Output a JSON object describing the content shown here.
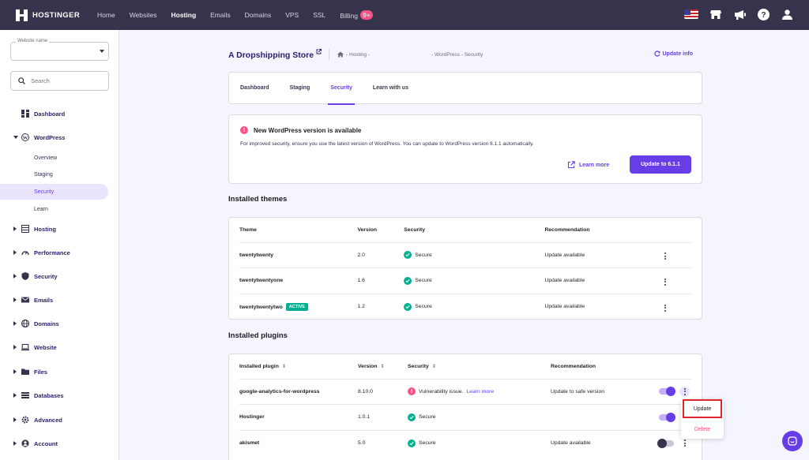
{
  "brand": {
    "name": "HOSTINGER"
  },
  "topnav": {
    "links": [
      "Home",
      "Websites",
      "Hosting",
      "Emails",
      "Domains",
      "VPS",
      "SSL",
      "Billing"
    ],
    "billing_badge": "9+"
  },
  "sidebar": {
    "website_select_label": "Website name",
    "search_placeholder": "Search",
    "items": [
      {
        "label": "Dashboard"
      },
      {
        "label": "WordPress"
      },
      {
        "label": "Hosting"
      },
      {
        "label": "Performance"
      },
      {
        "label": "Security"
      },
      {
        "label": "Emails"
      },
      {
        "label": "Domains"
      },
      {
        "label": "Website"
      },
      {
        "label": "Files"
      },
      {
        "label": "Databases"
      },
      {
        "label": "Advanced"
      },
      {
        "label": "Account"
      }
    ],
    "wp_subitems": [
      "Overview",
      "Staging",
      "Security",
      "Learn"
    ]
  },
  "header": {
    "site_title": "A Dropshipping Store",
    "breadcrumb_1": "- Hosting -",
    "breadcrumb_2": "- WordPress - Security",
    "update_info": "Update info"
  },
  "tabs": [
    "Dashboard",
    "Staging",
    "Security",
    "Learn with us"
  ],
  "alert": {
    "title": "New WordPress version is available",
    "description": "For improved security, ensure you use the latest version of WordPress. You can update to WordPress version 6.1.1 automatically.",
    "learn_more": "Learn more",
    "update_button": "Update to 6.1.1"
  },
  "themes": {
    "section_title": "Installed themes",
    "headers": [
      "Theme",
      "Version",
      "Security",
      "Recommendation"
    ],
    "rows": [
      {
        "name": "twentytwenty",
        "version": "2.0",
        "security": "Secure",
        "recommendation": "Update available"
      },
      {
        "name": "twentytwentyone",
        "version": "1.6",
        "security": "Secure",
        "recommendation": "Update available"
      },
      {
        "name": "twentytwentytwo",
        "version": "1.2",
        "security": "Secure",
        "recommendation": "Update available",
        "badge": "ACTIVE"
      }
    ]
  },
  "plugins": {
    "section_title": "Installed plugins",
    "headers": [
      "Installed plugin",
      "Version",
      "Security",
      "Recommendation"
    ],
    "rows": [
      {
        "name": "google-analytics-for-wordpress",
        "version": "8.10.0",
        "security": "Vulnerability issue.",
        "security_link": "Learn more",
        "recommendation": "Update to safe version",
        "enabled": true
      },
      {
        "name": "Hostinger",
        "version": "1.0.1",
        "security": "Secure",
        "recommendation": "",
        "enabled": true
      },
      {
        "name": "akismet",
        "version": "5.0",
        "security": "Secure",
        "recommendation": "Update available",
        "enabled": false
      }
    ]
  },
  "row_menu": {
    "update": "Update",
    "delete": "Delete"
  },
  "colors": {
    "accent": "#673de6",
    "nav_bg": "#36344d",
    "success": "#00b090",
    "danger": "#fc5185",
    "highlight": "#e0262c"
  }
}
